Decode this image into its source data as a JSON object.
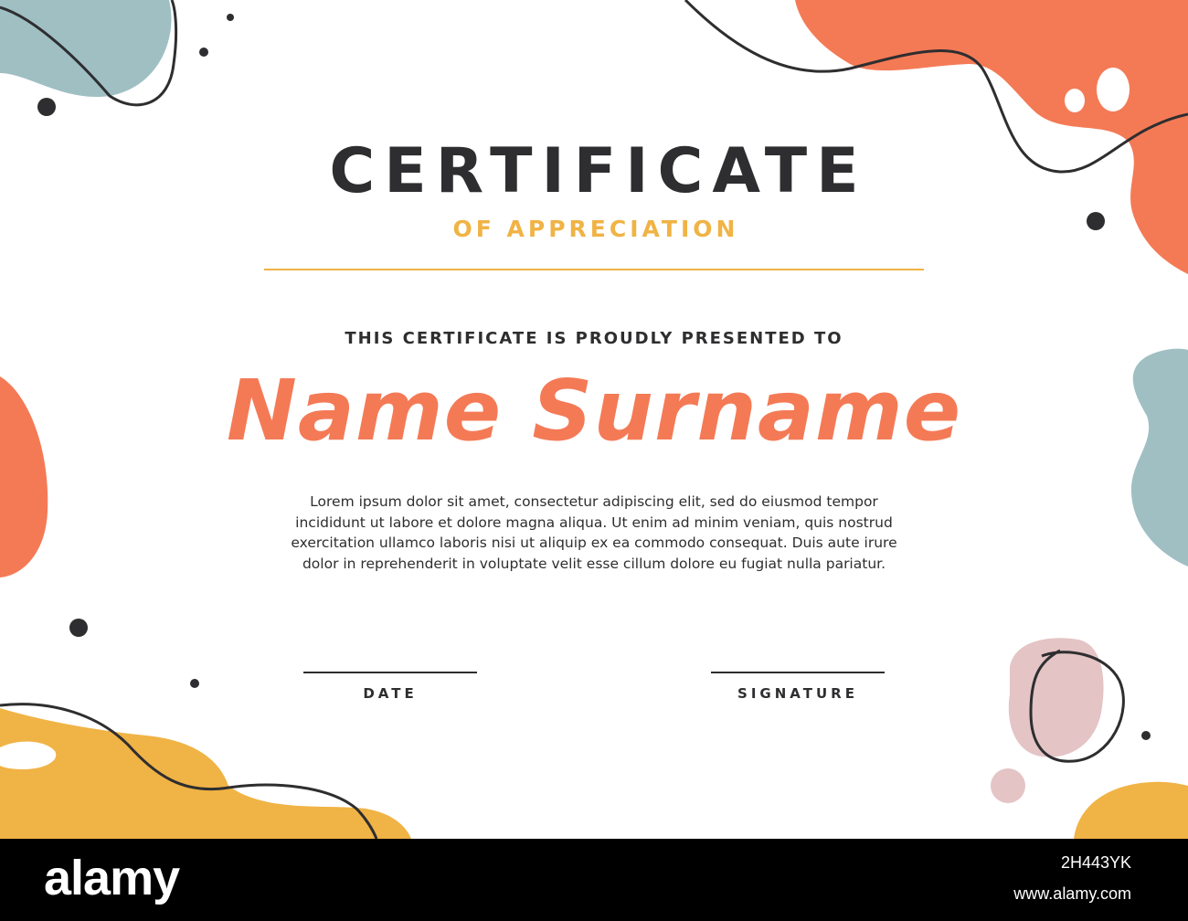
{
  "certificate": {
    "title": "CERTIFICATE",
    "subtitle": "OF APPRECIATION",
    "presented_to": "THIS CERTIFICATE IS PROUDLY PRESENTED TO",
    "recipient_name": "Name Surname",
    "body": "Lorem ipsum dolor sit amet, consectetur adipiscing elit, sed do eiusmod tempor incididunt ut labore et dolore magna aliqua. Ut enim ad minim veniam, quis nostrud exercitation ullamco laboris nisi ut aliquip ex ea commodo consequat. Duis aute irure dolor in reprehenderit in voluptate velit esse cillum dolore eu fugiat nulla pariatur.",
    "date_label": "DATE",
    "signature_label": "SIGNATURE"
  },
  "watermark": {
    "brand": "alamy",
    "image_id": "2H443YK",
    "url": "www.alamy.com"
  },
  "colors": {
    "coral": "#f47a56",
    "teal": "#9fbfc3",
    "mustard": "#f0b345",
    "pink": "#e4c4c5",
    "ink": "#2e2e30",
    "background": "#ffffff"
  }
}
